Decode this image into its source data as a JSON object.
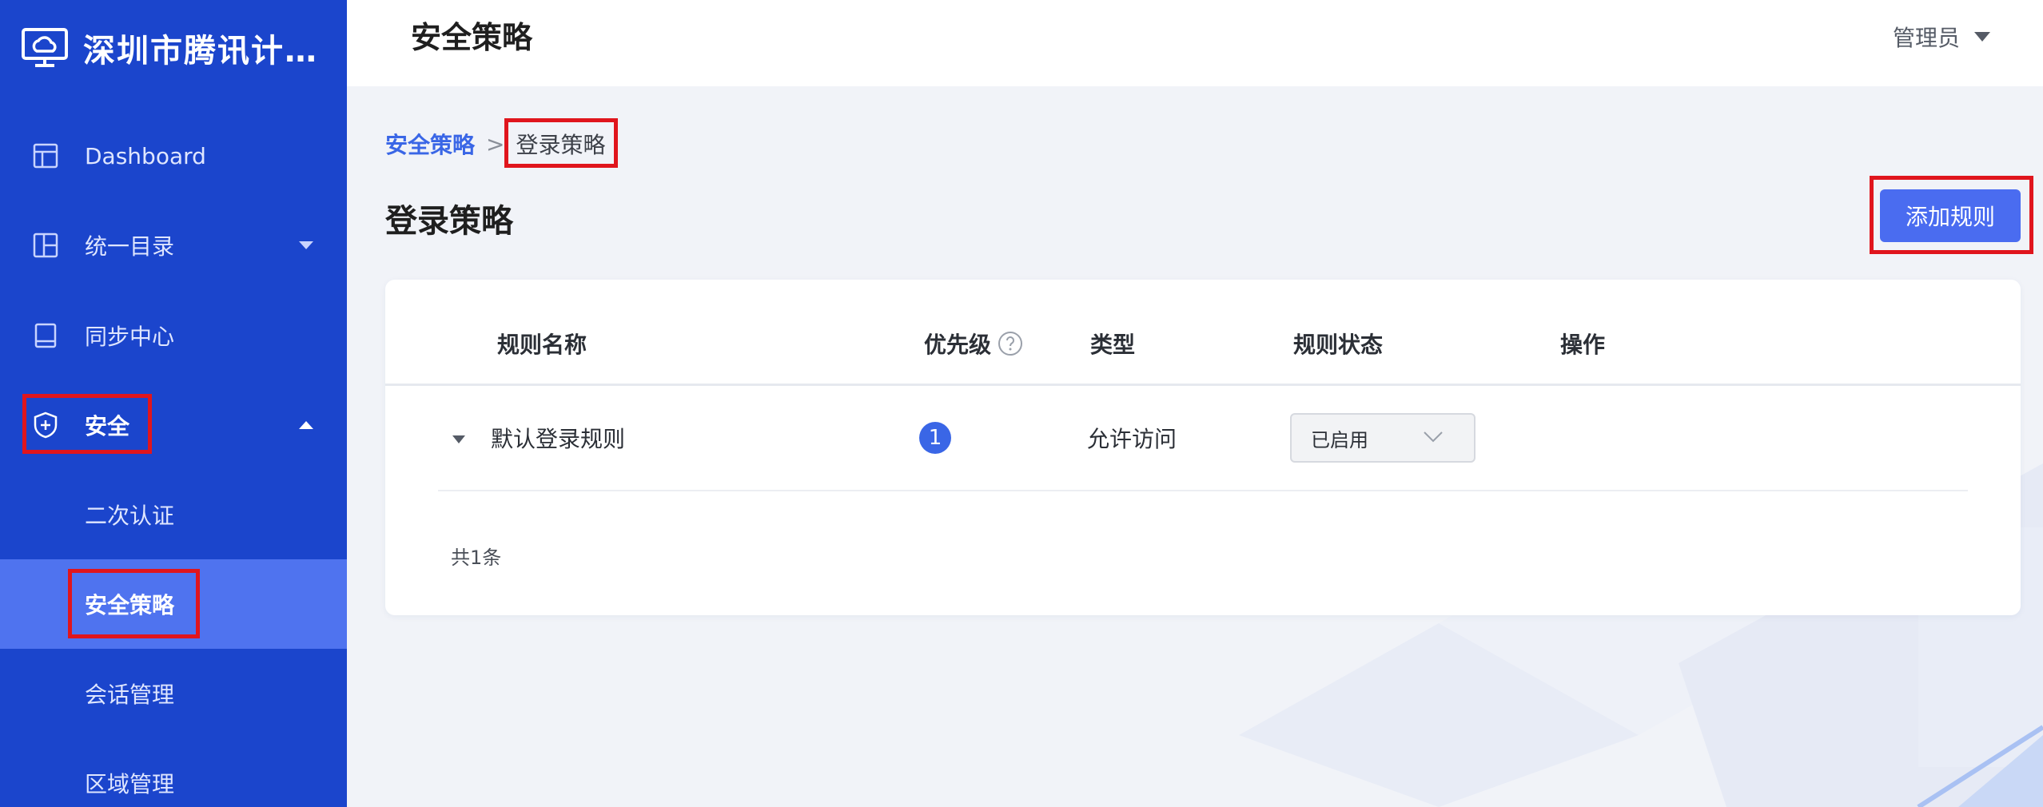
{
  "brand": {
    "title": "深圳市腾讯计..."
  },
  "sidebar": {
    "items": [
      {
        "label": "Dashboard",
        "icon": "layout-icon"
      },
      {
        "label": "统一目录",
        "icon": "columns-icon"
      },
      {
        "label": "同步中心",
        "icon": "tablet-icon"
      },
      {
        "label": "安全",
        "icon": "shield-plus-icon"
      },
      {
        "label": "二次认证"
      },
      {
        "label": "安全策略"
      },
      {
        "label": "会话管理"
      },
      {
        "label": "区域管理"
      }
    ]
  },
  "header": {
    "title": "安全策略",
    "user": "管理员"
  },
  "breadcrumb": {
    "parent": "安全策略",
    "separator": ">",
    "current": "登录策略"
  },
  "main": {
    "title": "登录策略",
    "add_button": "添加规则",
    "table": {
      "columns": [
        "规则名称",
        "优先级",
        "类型",
        "规则状态",
        "操作"
      ],
      "rows": [
        {
          "name": "默认登录规则",
          "priority": "1",
          "type": "允许访问",
          "status": "已启用"
        }
      ],
      "total": "共1条"
    }
  },
  "colors": {
    "sidebar_bg": "#1b45cc",
    "sidebar_selected": "#4f73ef",
    "accent": "#4a6cf0",
    "highlight_box": "#e0151d"
  }
}
